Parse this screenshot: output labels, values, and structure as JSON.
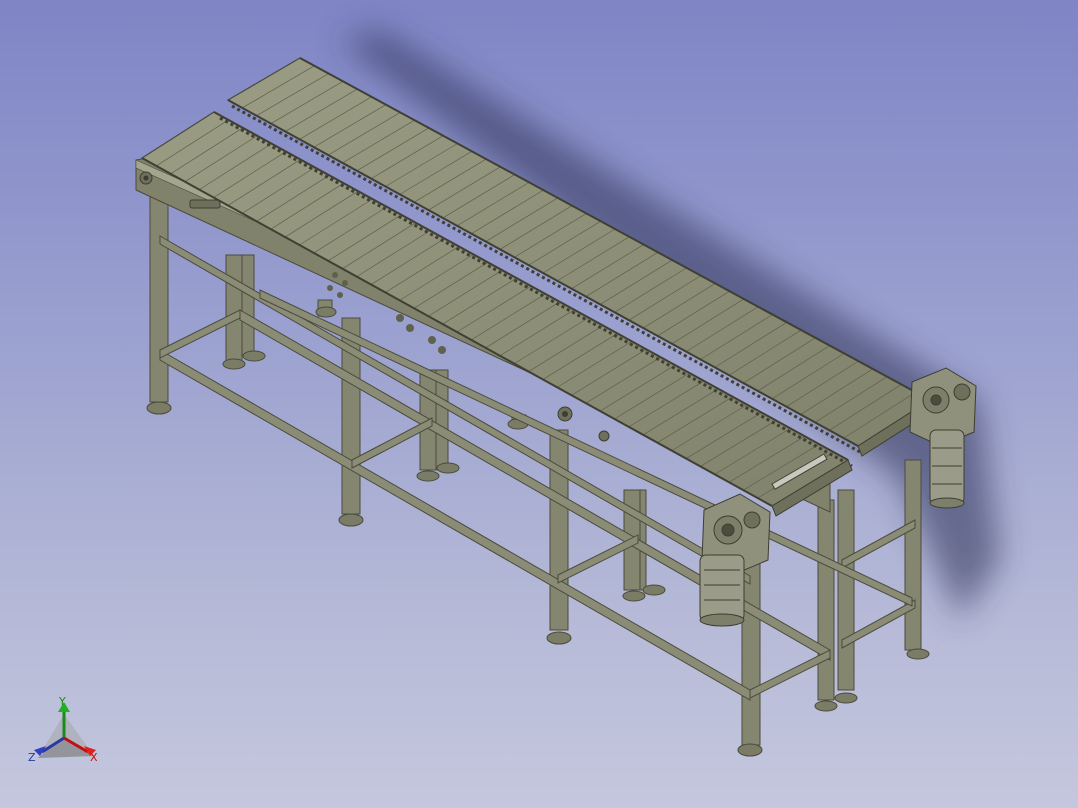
{
  "viewport": {
    "background_top": "#7f85c5",
    "background_bottom": "#c4c7dd"
  },
  "model": {
    "frame_color": "#84866f",
    "frame_dark": "#5f614d",
    "frame_light": "#a5a68f",
    "belt_color": "#8e9078",
    "motor_color": "#9a9b88"
  },
  "triad": {
    "x_label": "X",
    "y_label": "Y",
    "z_label": "Z",
    "x_color": "#c01010",
    "y_color": "#1a8a1a",
    "z_color": "#2a3aa0"
  }
}
